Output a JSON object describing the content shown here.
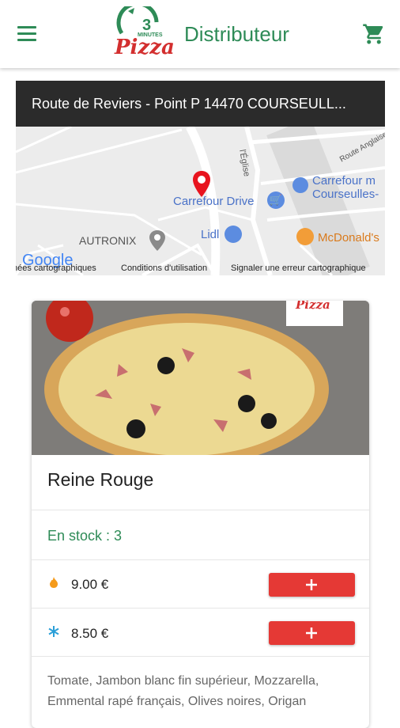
{
  "header": {
    "title": "Distributeur",
    "logo_top": "3",
    "logo_minutes": "MINUTES",
    "logo_word": "Pizza",
    "menu_icon": "menu-icon",
    "cart_icon": "cart-icon"
  },
  "address": "Route de Reviers - Point P 14470 COURSEULL...",
  "map": {
    "labels": {
      "carrefour_drive": "Carrefour Drive",
      "carrefour_market": "Carrefour m",
      "courseulles": "Courseulles-",
      "lidl": "Lidl",
      "autronix": "AUTRONIX",
      "mcdonalds": "McDonald's",
      "eglise": "l'Église",
      "anglaise": "Route Anglaise",
      "google": "Google"
    },
    "footer": {
      "data": "nées cartographiques",
      "terms": "Conditions d'utilisation",
      "report": "Signaler une erreur cartographique"
    }
  },
  "product": {
    "name": "Reine Rouge",
    "stock": "En stock : 3",
    "image_brand": "Pizza",
    "prices": [
      {
        "icon": "flame-icon",
        "value": "9.00 €",
        "button": "add-button-flame"
      },
      {
        "icon": "snowflake-icon",
        "value": "8.50 €",
        "button": "add-button-frozen"
      }
    ],
    "description": "Tomate, Jambon blanc fin supérieur, Mozzarella, Emmental rapé français, Olives noires, Origan"
  },
  "colors": {
    "brand_green": "#2e8b57",
    "accent_red": "#e53935",
    "address_bg": "#2b2b2b"
  }
}
